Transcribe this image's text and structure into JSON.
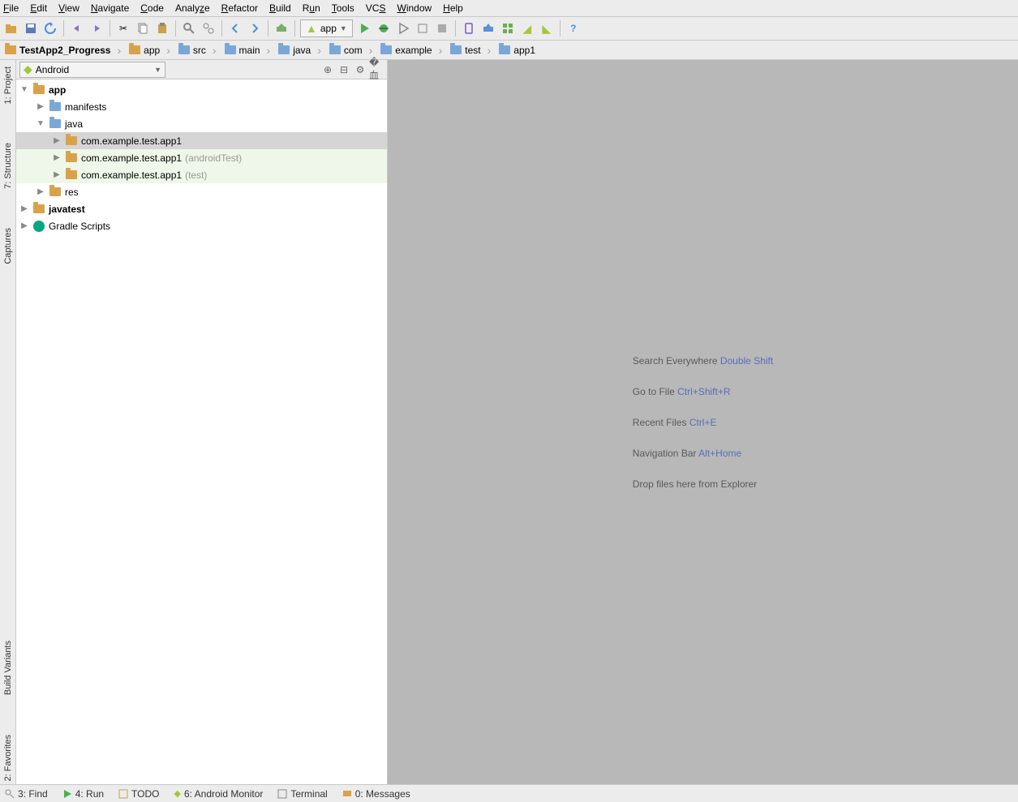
{
  "menu": [
    "File",
    "Edit",
    "View",
    "Navigate",
    "Code",
    "Analyze",
    "Refactor",
    "Build",
    "Run",
    "Tools",
    "VCS",
    "Window",
    "Help"
  ],
  "runConfig": "app",
  "breadcrumb": [
    "TestApp2_Progress",
    "app",
    "src",
    "main",
    "java",
    "com",
    "example",
    "test",
    "app1"
  ],
  "leftTabs": [
    "1: Project",
    "7: Structure",
    "Captures",
    "Build Variants",
    "2: Favorites"
  ],
  "panelHeader": {
    "view": "Android"
  },
  "tree": {
    "app": "app",
    "manifests": "manifests",
    "java": "java",
    "pkg1": "com.example.test.app1",
    "pkg2": "com.example.test.app1",
    "pkg2suffix": "(androidTest)",
    "pkg3": "com.example.test.app1",
    "pkg3suffix": "(test)",
    "res": "res",
    "javatest": "javatest",
    "gradle": "Gradle Scripts"
  },
  "tips": {
    "l1a": "Search Everywhere ",
    "l1b": "Double Shift",
    "l2a": "Go to File ",
    "l2b": "Ctrl+Shift+R",
    "l3a": "Recent Files ",
    "l3b": "Ctrl+E",
    "l4a": "Navigation Bar ",
    "l4b": "Alt+Home",
    "l5": "Drop files here from Explorer"
  },
  "bottom": {
    "find": "3: Find",
    "run": "4: Run",
    "todo": "TODO",
    "monitor": "6: Android Monitor",
    "terminal": "Terminal",
    "messages": "0: Messages"
  }
}
